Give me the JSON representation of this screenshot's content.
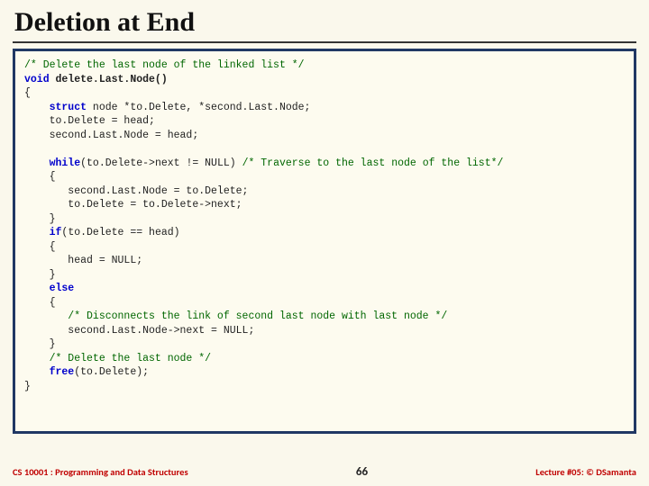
{
  "title": "Deletion at End",
  "code": {
    "l01": "/* Delete the last node of the linked list */",
    "l02a": "void",
    "l02b": " delete.Last.Node()",
    "l03": "{",
    "l04a": "    struct",
    "l04b": " node *to.Delete, *second.Last.Node;",
    "l05": "    to.Delete = head;",
    "l06": "    second.Last.Node = head;",
    "l07": "",
    "l08a": "    while",
    "l08b": "(to.Delete->next != NULL) ",
    "l08c": "/* Traverse to the last node of the list*/",
    "l09": "    {",
    "l10": "       second.Last.Node = to.Delete;",
    "l11": "       to.Delete = to.Delete->next;",
    "l12": "    }",
    "l13a": "    if",
    "l13b": "(to.Delete == head)",
    "l14": "    {",
    "l15": "       head = NULL;",
    "l16": "    }",
    "l17a": "    else",
    "l18": "    {",
    "l19": "       /* Disconnects the link of second last node with last node */",
    "l20": "       second.Last.Node->next = NULL;",
    "l21": "    }",
    "l22": "    /* Delete the last node */",
    "l23a": "    free",
    "l23b": "(to.Delete);",
    "l24": "}"
  },
  "footer": {
    "left": "CS 10001 : Programming and Data Structures",
    "page": "66",
    "right": "Lecture #05: © DSamanta"
  }
}
